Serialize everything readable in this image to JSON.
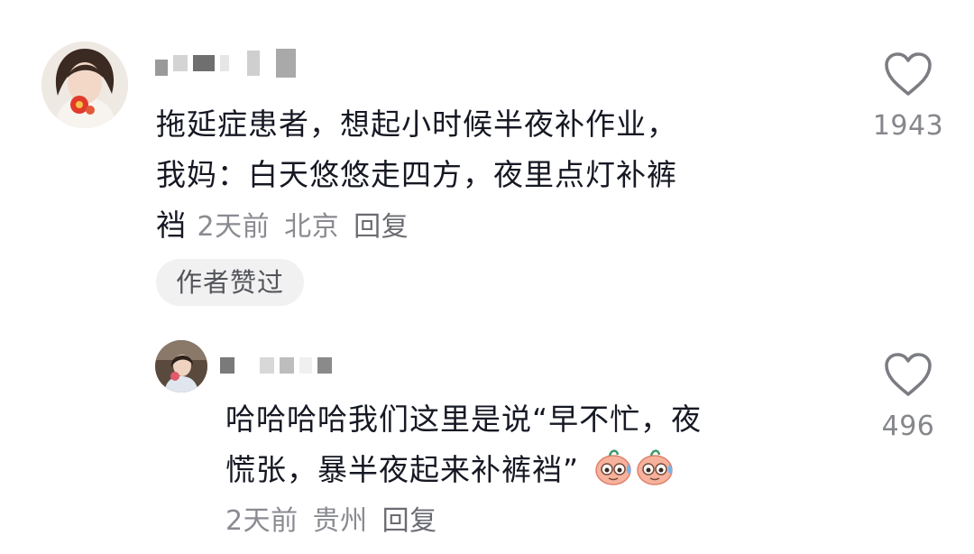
{
  "comments": [
    {
      "text_line1": "拖延症患者，想起小时候半夜补作业，",
      "text_line2": "我妈：白天悠悠走四方，夜里点灯补裤",
      "text_line3_start": "裆",
      "time": "2天前",
      "location": "北京",
      "reply_label": "回复",
      "badge": "作者赞过",
      "like_count": "1943",
      "avatar_icon": "avatar-woman-with-red-flower-icon",
      "username_blurred": true
    },
    {
      "text_line1": "哈哈哈哈我们这里是说“早不忙，夜",
      "text_line2": "慌张，暴半夜起来补裤裆”",
      "emoji": [
        "sweating-face-emoji",
        "sweating-face-emoji"
      ],
      "time": "2天前",
      "location": "贵州",
      "reply_label": "回复",
      "like_count": "496",
      "avatar_icon": "avatar-girl-with-flower-icon",
      "username_blurred": true
    }
  ],
  "colors": {
    "text": "#161823",
    "meta": "#8a8b91",
    "badge_bg": "#f1f1f2",
    "heart_outline": "#7c7d82"
  }
}
